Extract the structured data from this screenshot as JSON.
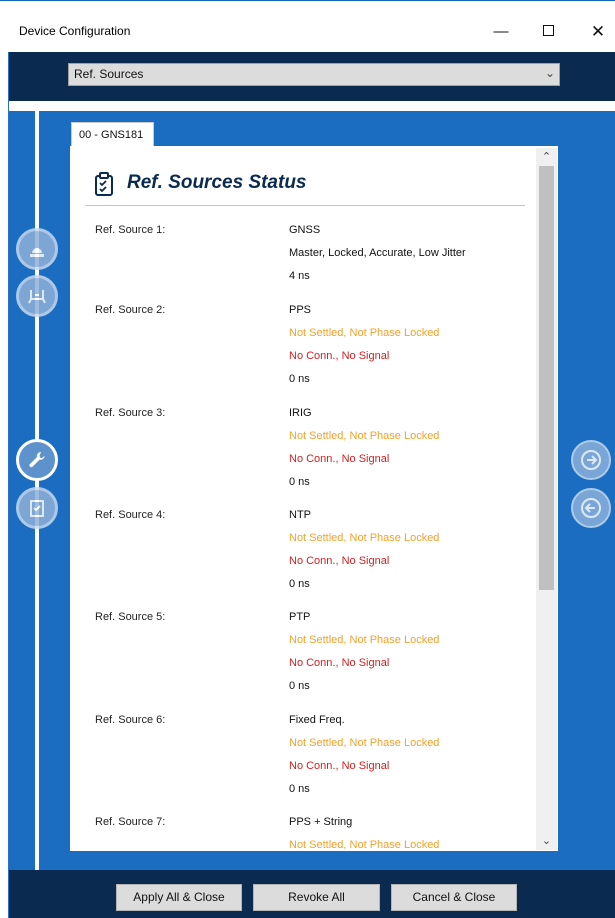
{
  "window": {
    "title": "Device Configuration",
    "minimize_glyph": "—",
    "close_glyph": "✕"
  },
  "header": {
    "selected_option": "Ref. Sources",
    "chevron_glyph": "⌄"
  },
  "tab": {
    "label": "00 - GNS181"
  },
  "panel": {
    "title": "Ref. Sources Status",
    "rows": [
      {
        "label": "Ref. Source 1:",
        "values": [
          {
            "text": "GNSS",
            "status": "normal"
          },
          {
            "text": "Master, Locked, Accurate, Low Jitter",
            "status": "normal"
          },
          {
            "text": "4 ns",
            "status": "normal"
          }
        ]
      },
      {
        "label": "Ref. Source 2:",
        "values": [
          {
            "text": "PPS",
            "status": "normal"
          },
          {
            "text": "Not Settled, Not Phase Locked",
            "status": "warn"
          },
          {
            "text": "No Conn., No Signal",
            "status": "err"
          },
          {
            "text": "0 ns",
            "status": "normal"
          }
        ]
      },
      {
        "label": "Ref. Source 3:",
        "values": [
          {
            "text": "IRIG",
            "status": "normal"
          },
          {
            "text": "Not Settled, Not Phase Locked",
            "status": "warn"
          },
          {
            "text": "No Conn., No Signal",
            "status": "err"
          },
          {
            "text": "0 ns",
            "status": "normal"
          }
        ]
      },
      {
        "label": "Ref. Source 4:",
        "values": [
          {
            "text": "NTP",
            "status": "normal"
          },
          {
            "text": "Not Settled, Not Phase Locked",
            "status": "warn"
          },
          {
            "text": "No Conn., No Signal",
            "status": "err"
          },
          {
            "text": "0 ns",
            "status": "normal"
          }
        ]
      },
      {
        "label": "Ref. Source 5:",
        "values": [
          {
            "text": "PTP",
            "status": "normal"
          },
          {
            "text": "Not Settled, Not Phase Locked",
            "status": "warn"
          },
          {
            "text": "No Conn., No Signal",
            "status": "err"
          },
          {
            "text": "0 ns",
            "status": "normal"
          }
        ]
      },
      {
        "label": "Ref. Source 6:",
        "values": [
          {
            "text": "Fixed Freq.",
            "status": "normal"
          },
          {
            "text": "Not Settled, Not Phase Locked",
            "status": "warn"
          },
          {
            "text": "No Conn., No Signal",
            "status": "err"
          },
          {
            "text": "0 ns",
            "status": "normal"
          }
        ]
      },
      {
        "label": "Ref. Source 7:",
        "values": [
          {
            "text": "PPS + String",
            "status": "normal"
          },
          {
            "text": "Not Settled, Not Phase Locked",
            "status": "warn"
          }
        ]
      }
    ]
  },
  "sidebar": {
    "icons": [
      {
        "name": "device-icon",
        "glyph": "☁"
      },
      {
        "name": "network-icon",
        "glyph": "⚇"
      },
      {
        "name": "wrench-icon",
        "glyph": "🔧"
      },
      {
        "name": "checklist-icon",
        "glyph": "📋"
      }
    ]
  },
  "nav": {
    "next_glyph": "➔",
    "prev_glyph": "⬅"
  },
  "footer": {
    "apply_label": "Apply All & Close",
    "revoke_label": "Revoke All",
    "cancel_label": "Cancel & Close"
  },
  "colors": {
    "header_bg": "#0a2a4f",
    "main_bg": "#1a6dc0",
    "warn": "#f5a02a",
    "error": "#d21f1f"
  }
}
